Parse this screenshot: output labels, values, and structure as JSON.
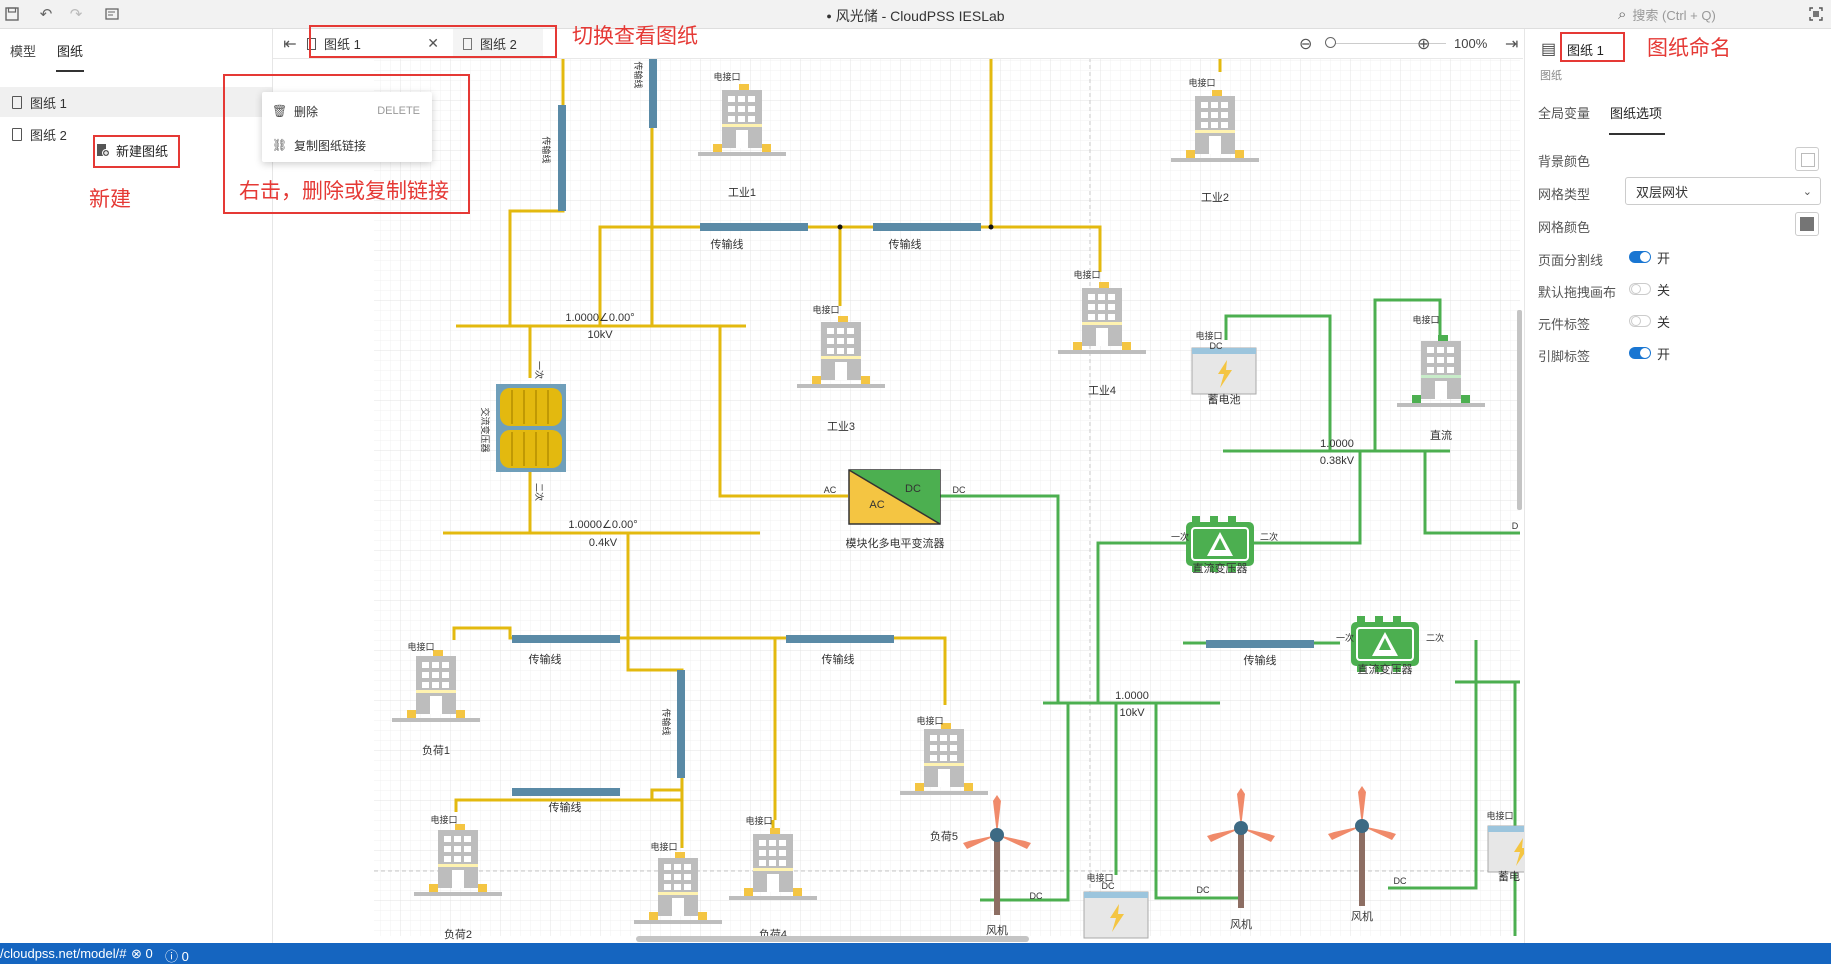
{
  "titlebar": {
    "title": "风光储 - CloudPSS IESLab",
    "search_placeholder": "搜索 (Ctrl + Q)"
  },
  "left_panel": {
    "tabs": [
      "模型",
      "图纸"
    ],
    "sheets": [
      "图纸 1",
      "图纸 2"
    ],
    "new_sheet_label": "新建图纸"
  },
  "context_menu": {
    "delete_label": "删除",
    "delete_shortcut": "DELETE",
    "copy_link_label": "复制图纸链接"
  },
  "sheet_tabs": [
    "图纸 1",
    "图纸 2"
  ],
  "zoom": {
    "level": "100%",
    "slider_fraction": 0.0
  },
  "annotations": {
    "switch_view": "切换查看图纸",
    "right_click": "右击，删除或复制链接",
    "new": "新建",
    "rename": "图纸命名"
  },
  "right_panel": {
    "sheet_name": "图纸 1",
    "sub_label": "图纸",
    "tabs": [
      "全局变量",
      "图纸选项"
    ],
    "active_tab": "图纸选项",
    "rows": {
      "bg_color_label": "背景颜色",
      "grid_type_label": "网格类型",
      "grid_type_value": "双层网状",
      "grid_color_label": "网格颜色",
      "page_split_label": "页面分割线",
      "page_split_value": "开",
      "default_drag_label": "默认拖拽画布",
      "default_drag_value": "关",
      "component_label": "元件标签",
      "component_value": "关",
      "pin_label": "引脚标签",
      "pin_value": "开"
    },
    "colors": {
      "bg_swatch": "#ffffff",
      "grid_swatch": "#757575",
      "toggle_on": "#1976d2",
      "toggle_off": "#cccccc"
    }
  },
  "status": {
    "url": "/cloudpss.net/model/#",
    "errors": "0",
    "infos": "0"
  },
  "diagram": {
    "colors": {
      "ac_line": "#e3b90f",
      "dc_line": "#4caf50",
      "tline": "#5a8aa6",
      "building": "#bdbdbd"
    },
    "port_label": "电接口",
    "tline_label": "传输线",
    "bus_ac_high": {
      "value": "1.0000∠0.00°",
      "voltage": "10kV"
    },
    "bus_ac_low": {
      "value": "1.0000∠0.00°",
      "voltage": "0.4kV"
    },
    "bus_dc_high": {
      "value": "1.0000",
      "voltage": "10kV"
    },
    "bus_dc_low": {
      "value": "1.0000",
      "voltage": "0.38kV"
    },
    "transformer": {
      "name": "交流变压器",
      "primary": "一次",
      "secondary": "二次"
    },
    "converter": {
      "name": "模块化多电平变流器",
      "ac": "AC",
      "dc": "DC"
    },
    "dc_transformer": {
      "name": "直流变压器",
      "primary": "一次",
      "secondary": "二次"
    },
    "loads": [
      "工业1",
      "工业2",
      "工业3",
      "工业4",
      "负荷1",
      "负荷2",
      "负荷4",
      "负荷5",
      "直流"
    ],
    "battery": "蓄电池",
    "battery_cut": "蓄电",
    "wind": "风机",
    "dc_tag": "DC",
    "dc_cut": "D"
  }
}
